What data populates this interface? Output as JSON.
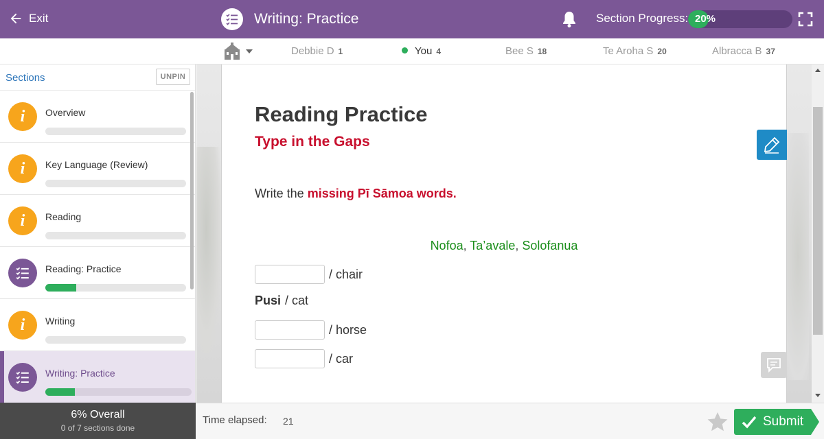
{
  "header": {
    "exit_label": "Exit",
    "title": "Writing: Practice",
    "progress_label": "Section Progress:",
    "progress_value": "20%",
    "progress_fraction": 0.2
  },
  "leaderboard": [
    {
      "name": "Debbie D",
      "score": "1"
    },
    {
      "name": "You",
      "score": "4"
    },
    {
      "name": "Bee S",
      "score": "18"
    },
    {
      "name": "Te Aroha S",
      "score": "20"
    },
    {
      "name": "Albracca B",
      "score": "37"
    }
  ],
  "sidebar": {
    "title": "Sections",
    "unpin_label": "UNPIN",
    "items": [
      {
        "label": "Overview",
        "icon": "info-icon",
        "progress": 0
      },
      {
        "label": "Key Language (Review)",
        "icon": "info-icon",
        "progress": 0
      },
      {
        "label": "Reading",
        "icon": "info-icon",
        "progress": 0
      },
      {
        "label": "Reading: Practice",
        "icon": "checklist-icon",
        "progress": 0.22
      },
      {
        "label": "Writing",
        "icon": "info-icon",
        "progress": 0
      },
      {
        "label": "Writing: Practice",
        "icon": "checklist-icon",
        "progress": 0.2,
        "active": true
      }
    ],
    "overall": "6% Overall",
    "sections_done": "0 of 7 sections done"
  },
  "content": {
    "heading": "Reading Practice",
    "subheading": "Type in the Gaps",
    "instruction_prefix": "Write the ",
    "instruction_highlight": "missing Pī Sāmoa words.",
    "word_bank": [
      "Nofoa",
      "Ta’avale",
      "Solofanua"
    ],
    "word_bank_sep": ", ",
    "rows": [
      {
        "value": "",
        "given": "",
        "suffix": "/ chair"
      },
      {
        "given": "Pusi",
        "suffix": "/ cat"
      },
      {
        "value": "",
        "given": "",
        "suffix": "/ horse"
      },
      {
        "value": "",
        "given": "",
        "suffix": "/ car"
      }
    ]
  },
  "footer": {
    "time_label": "Time elapsed:",
    "time_value": "21",
    "submit_label": "Submit"
  },
  "colors": {
    "brand_purple": "#7b5796",
    "progress_green": "#2eae5c",
    "accent_red": "#c8102e",
    "word_green": "#1a8e1a",
    "info_orange": "#f7a51c",
    "tool_blue": "#1f8bc6"
  }
}
